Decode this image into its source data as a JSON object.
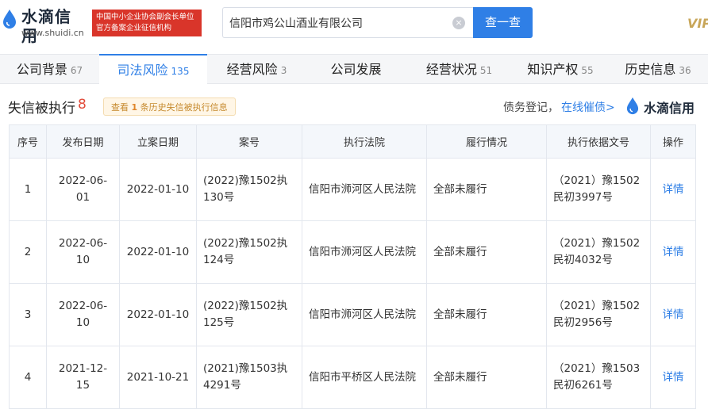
{
  "brand": {
    "name": "水滴信用",
    "url": "www.shuidi.cn",
    "badge_line1": "中国中小企业协会副会长单位",
    "badge_line2": "官方备案企业征信机构"
  },
  "search": {
    "value": "信阳市鸡公山酒业有限公司",
    "clear_icon": "×",
    "button_label": "查一查"
  },
  "vip_label": "VIP",
  "tabs": [
    {
      "label": "公司背景",
      "count": "67"
    },
    {
      "label": "司法风险",
      "count": "135"
    },
    {
      "label": "经营风险",
      "count": "3"
    },
    {
      "label": "公司发展",
      "count": ""
    },
    {
      "label": "经营状况",
      "count": "51"
    },
    {
      "label": "知识产权",
      "count": "55"
    },
    {
      "label": "历史信息",
      "count": "36"
    }
  ],
  "section": {
    "title": "失信被执行",
    "count": "8",
    "history_prefix": "查看",
    "history_number": "1",
    "history_suffix": "条历史失信被执行信息",
    "debt_text": "债务登记，",
    "debt_link": "在线催债>",
    "brand": "水滴信用"
  },
  "table": {
    "headers": [
      "序号",
      "发布日期",
      "立案日期",
      "案号",
      "执行法院",
      "履行情况",
      "执行依据文号",
      "操作"
    ],
    "rows": [
      {
        "no": "1",
        "publish": "2022-06-01",
        "filed": "2022-01-10",
        "case": "(2022)豫1502执130号",
        "court": "信阳市浉河区人民法院",
        "status": "全部未履行",
        "basis": "（2021）豫1502民初3997号",
        "action": "详情"
      },
      {
        "no": "2",
        "publish": "2022-06-10",
        "filed": "2022-01-10",
        "case": "(2022)豫1502执124号",
        "court": "信阳市浉河区人民法院",
        "status": "全部未履行",
        "basis": "（2021）豫1502民初4032号",
        "action": "详情"
      },
      {
        "no": "3",
        "publish": "2022-06-10",
        "filed": "2022-01-10",
        "case": "(2022)豫1502执125号",
        "court": "信阳市浉河区人民法院",
        "status": "全部未履行",
        "basis": "（2021）豫1502民初2956号",
        "action": "详情"
      },
      {
        "no": "4",
        "publish": "2021-12-15",
        "filed": "2021-10-21",
        "case": "(2021)豫1503执4291号",
        "court": "信阳市平桥区人民法院",
        "status": "全部未履行",
        "basis": "（2021）豫1503民初6261号",
        "action": "详情"
      }
    ]
  },
  "colors": {
    "accent": "#2f7fe6",
    "badge": "#d9352a",
    "count_red": "#e24c3b",
    "header_bg": "#f4f7fb"
  }
}
